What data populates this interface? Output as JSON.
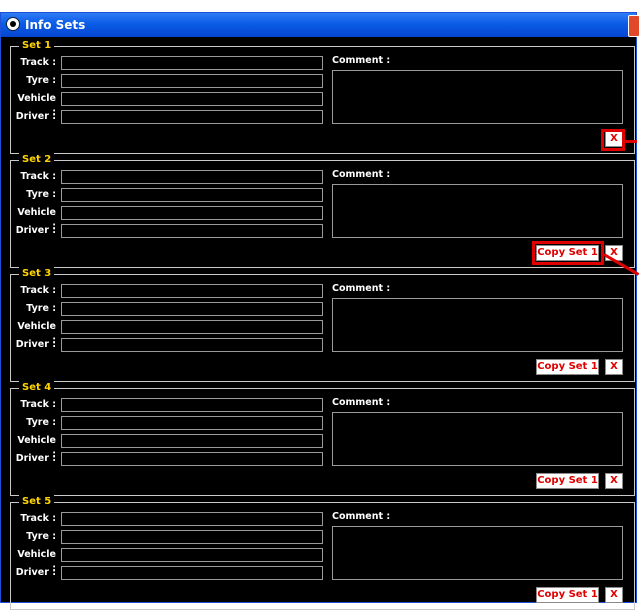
{
  "window": {
    "title": "Info Sets"
  },
  "field_labels": {
    "track": "Track :",
    "tyre": "Tyre :",
    "vehicle": "Vehicle :",
    "driver": "Driver :",
    "comment": "Comment :"
  },
  "sets": [
    {
      "legend": "Set 1",
      "remove_label": "X"
    },
    {
      "legend": "Set 2",
      "copy_label": "Copy Set 1",
      "remove_label": "X"
    },
    {
      "legend": "Set 3",
      "copy_label": "Copy Set 1",
      "remove_label": "X"
    },
    {
      "legend": "Set 4",
      "copy_label": "Copy Set 1",
      "remove_label": "X"
    },
    {
      "legend": "Set 5",
      "copy_label": "Copy Set 1",
      "remove_label": "X"
    }
  ],
  "colors": {
    "legend": "#ffd400",
    "button_text": "#e00000",
    "highlight": "#e00000",
    "titlebar": "#0b5ce6"
  }
}
